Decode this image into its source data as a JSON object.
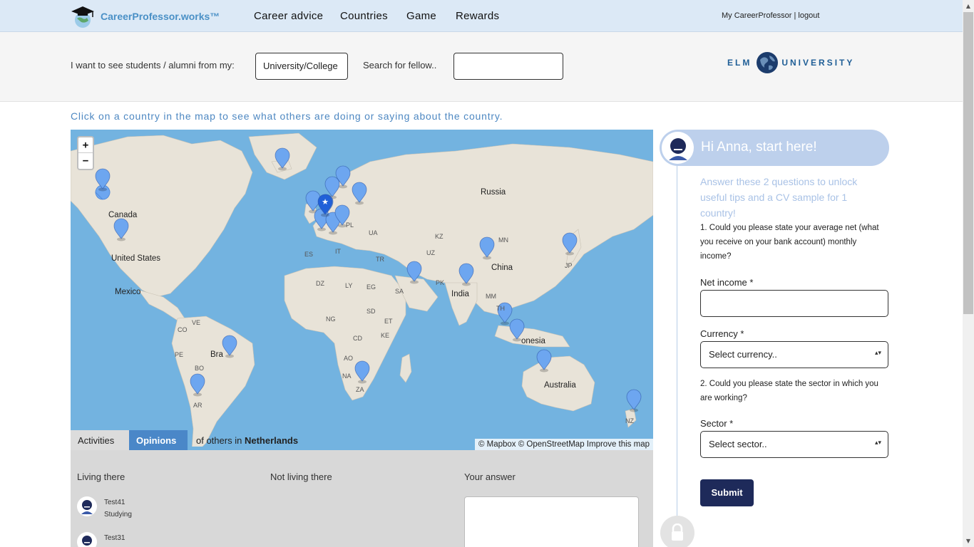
{
  "brand": {
    "name": "CareerProfessor.works™",
    "logo_icon": "graduation-cap-globe-icon"
  },
  "nav": {
    "items": [
      "Career advice",
      "Countries",
      "Game",
      "Rewards"
    ]
  },
  "user": {
    "account_link": "My CareerProfessor",
    "separator": "|",
    "logout": "logout"
  },
  "filter": {
    "label": "I want to see students / alumni from my:",
    "select_value": "University/College",
    "search_label": "Search for fellow..",
    "search_value": ""
  },
  "partner": {
    "left": "ELM",
    "right": "UNIVERSITY"
  },
  "instruction": "Click on a country in the map to see what others are doing or saying about the country.",
  "map": {
    "labels": {
      "russia": "Russia",
      "canada": "Canada",
      "united_states": "United States",
      "mexico": "Mexico",
      "china": "China",
      "india": "India",
      "australia": "Australia",
      "onesia": "onesia",
      "bra": "Bra",
      "kz": "KZ",
      "mn": "MN",
      "uz": "UZ",
      "tr": "TR",
      "es": "ES",
      "it": "IT",
      "ua": "UA",
      "pl": "PL",
      "dz": "DZ",
      "ly": "LY",
      "eg": "EG",
      "sa": "SA",
      "pk": "PK",
      "mm": "MM",
      "th": "TH",
      "ng": "NG",
      "sd": "SD",
      "et": "ET",
      "cd": "CD",
      "ke": "KE",
      "ao": "AO",
      "na": "NA",
      "za": "ZA",
      "ve": "VE",
      "co": "CO",
      "pe": "PE",
      "bo": "BO",
      "ar": "AR",
      "jp": "JP",
      "nz": "NZ"
    },
    "zoom_in": "+",
    "zoom_out": "−",
    "attribution": "© Mapbox © OpenStreetMap Improve this map",
    "marker_color": "#6da6f0",
    "selected_marker_color": "#2060d8"
  },
  "tabs": {
    "activities": "Activities",
    "opinions": "Opinions",
    "caption_prefix": "of others in",
    "country": "Netherlands"
  },
  "panel": {
    "col_living": "Living there",
    "col_not_living": "Not living there",
    "col_answer": "Your answer",
    "people": [
      {
        "name": "Test41",
        "status": "Studying"
      },
      {
        "name": "Test31",
        "status": ""
      }
    ]
  },
  "questionnaire": {
    "greeting": "Hi Anna, start here!",
    "intro": "Answer these 2 questions to unlock useful tips and a CV sample for 1 country!",
    "q1": "1. Could you please state your average net (what you receive on your bank account) monthly income?",
    "net_income_label": "Net income *",
    "currency_label": "Currency *",
    "currency_value": "Select currency..",
    "q2": "2. Could you please state the sector in which you are working?",
    "sector_label": "Sector *",
    "sector_value": "Select sector..",
    "submit": "Submit",
    "lock_icon": "lock-icon"
  },
  "colors": {
    "nav_bg": "#dce9f6",
    "accent": "#4a87c8",
    "submit_bg": "#1e2a5a",
    "ocean": "#73b3e0",
    "land": "#e8e3d8"
  }
}
